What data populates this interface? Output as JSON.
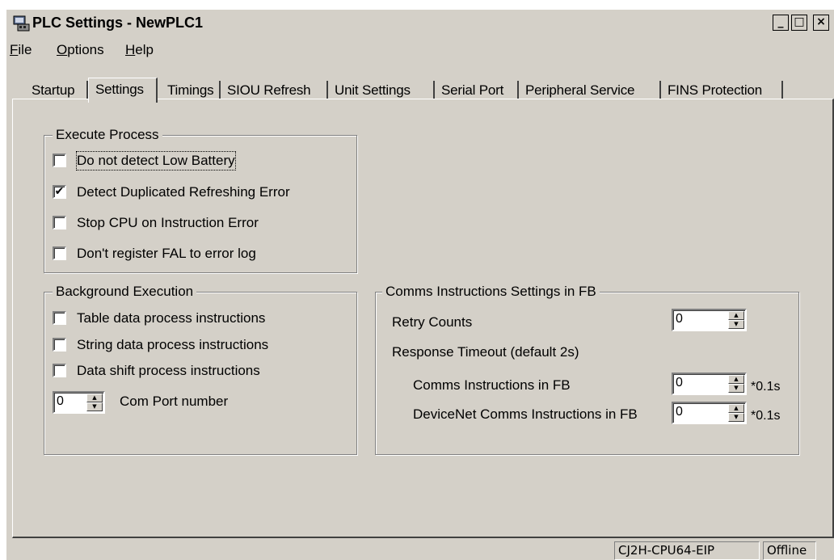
{
  "window": {
    "title": "PLC Settings - NewPLC1",
    "controls": {
      "minimize": "_",
      "maximize": "□",
      "close": "×"
    }
  },
  "menu": [
    {
      "mnemonic": "F",
      "rest": "ile"
    },
    {
      "mnemonic": "O",
      "rest": "ptions"
    },
    {
      "mnemonic": "H",
      "rest": "elp"
    }
  ],
  "tabs": [
    "Startup",
    "Settings",
    "Timings",
    "SIOU Refresh",
    "Unit Settings",
    "Serial Port",
    "Peripheral Service",
    "FINS Protection"
  ],
  "active_tab": "Settings",
  "execute_process": {
    "title": "Execute Process",
    "items": [
      {
        "label": "Do not detect Low Battery",
        "checked": false
      },
      {
        "label": "Detect Duplicated Refreshing Error",
        "checked": true
      },
      {
        "label": "Stop CPU on Instruction Error",
        "checked": false
      },
      {
        "label": "Don't register FAL to error log",
        "checked": false
      }
    ]
  },
  "background_execution": {
    "title": "Background Execution",
    "items": [
      {
        "label": "Table data process instructions",
        "checked": false
      },
      {
        "label": "String data process instructions",
        "checked": false
      },
      {
        "label": "Data shift process instructions",
        "checked": false
      }
    ],
    "com_port": {
      "value": "0",
      "label": "Com Port number"
    }
  },
  "comms_fb": {
    "title": "Comms Instructions Settings in FB",
    "retry": {
      "label": "Retry Counts",
      "value": "0"
    },
    "response_timeout_label": "Response Timeout (default 2s)",
    "comms": {
      "label": "Comms Instructions in FB",
      "value": "0",
      "unit": "*0.1s"
    },
    "devicenet": {
      "label": "DeviceNet Comms Instructions in FB",
      "value": "0",
      "unit": "*0.1s"
    }
  },
  "status": {
    "model": "CJ2H-CPU64-EIP",
    "mode": "Offline"
  }
}
